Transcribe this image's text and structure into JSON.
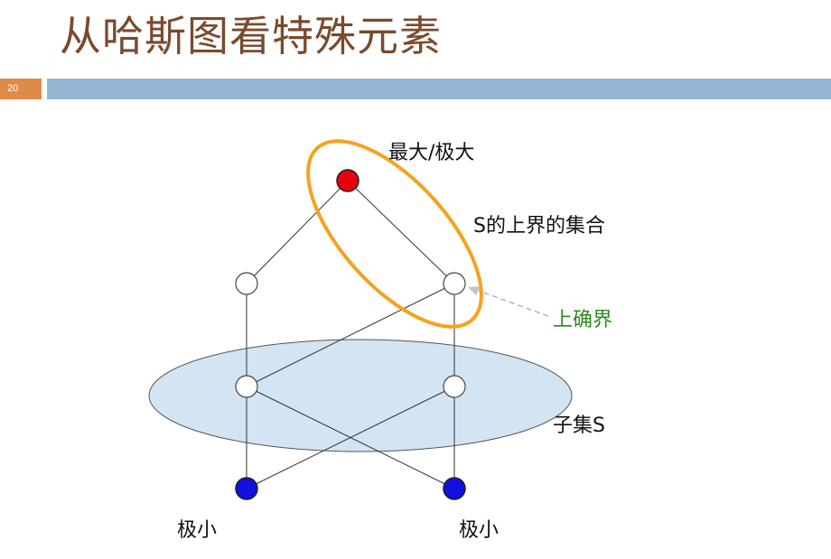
{
  "slide": {
    "title": "从哈斯图看特殊元素",
    "number": "20"
  },
  "diagram": {
    "labels": {
      "max": "最大/极大",
      "upper_bounds": "S的上界的集合",
      "lub": "上确界",
      "subset": "子集S",
      "min_left": "极小",
      "min_right": "极小"
    },
    "colors": {
      "max_node": "#e8000f",
      "min_node": "#1010e0",
      "plain_node": "#ffffff",
      "upper_ellipse": "#f5a21e",
      "subset_fill": "#d3e4f2",
      "lub_label": "#2c8a1f",
      "edge": "#333333"
    }
  }
}
